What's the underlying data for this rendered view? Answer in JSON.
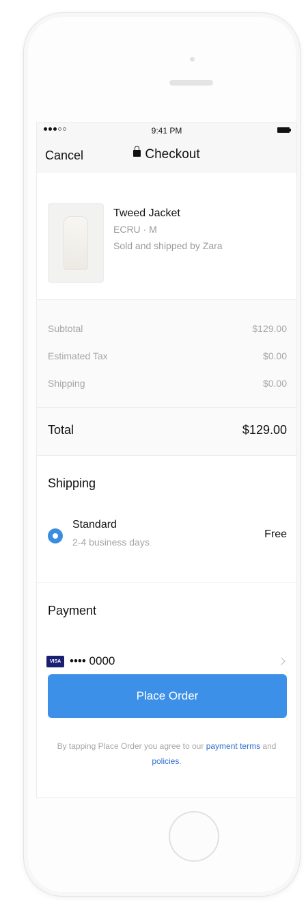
{
  "status": {
    "time": "9:41 PM"
  },
  "nav": {
    "cancel_label": "Cancel",
    "title": "Checkout"
  },
  "product": {
    "name": "Tweed Jacket",
    "variant": "ECRU · M",
    "seller": "Sold and shipped by Zara"
  },
  "summary": {
    "rows": [
      {
        "label": "Subtotal",
        "value": "$129.00"
      },
      {
        "label": "Estimated Tax",
        "value": "$0.00"
      },
      {
        "label": "Shipping",
        "value": "$0.00"
      }
    ],
    "total_label": "Total",
    "total_value": "$129.00"
  },
  "shipping": {
    "heading": "Shipping",
    "method": "Standard",
    "days": "2-4 business days",
    "price": "Free"
  },
  "payment": {
    "heading": "Payment",
    "card_brand": "VISA",
    "card_number": "•••• 0000"
  },
  "place_order_label": "Place Order",
  "terms": {
    "prefix": "By tapping Place Order you agree to our",
    "link1": "payment terms",
    "middle": "and",
    "link2": "policies",
    "suffix": "."
  },
  "colors": {
    "accent": "#3d90e8",
    "visa": "#1a1f71"
  }
}
